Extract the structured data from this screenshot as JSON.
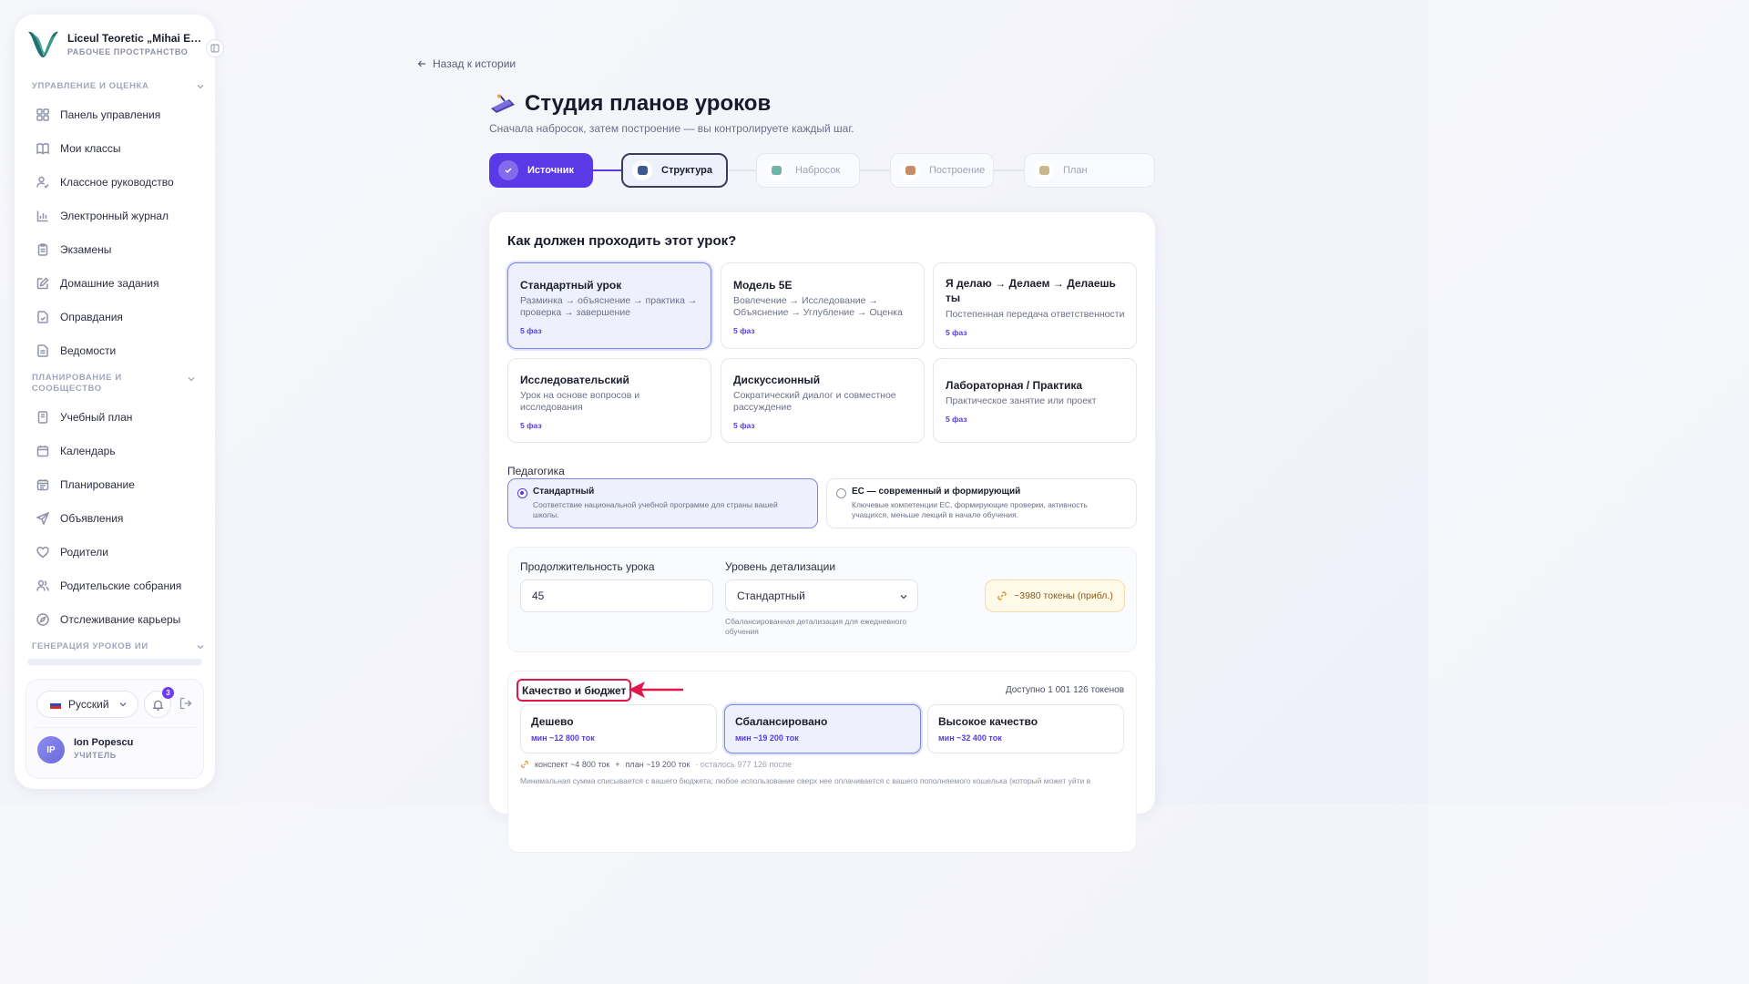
{
  "sidebar": {
    "school_name": "Liceul Teoretic „Mihai Eminescu”",
    "workspace_label": "РАБОЧЕЕ ПРОСТРАНСТВО",
    "sections": [
      {
        "title": "УПРАВЛЕНИЕ И ОЦЕНКА"
      },
      {
        "title": "ПЛАНИРОВАНИЕ И СООБЩЕСТВО"
      },
      {
        "title": "ГЕНЕРАЦИЯ УРОКОВ ИИ"
      }
    ],
    "items": [
      {
        "label": "Панель управления",
        "icon": "dashboard-icon"
      },
      {
        "label": "Мои классы",
        "icon": "book-icon"
      },
      {
        "label": "Классное руководство",
        "icon": "user-check-icon"
      },
      {
        "label": "Электронный журнал",
        "icon": "bar-chart-icon"
      },
      {
        "label": "Экзамены",
        "icon": "clipboard-icon"
      },
      {
        "label": "Домашние задания",
        "icon": "edit-icon"
      },
      {
        "label": "Оправдания",
        "icon": "file-check-icon"
      },
      {
        "label": "Ведомости",
        "icon": "file-text-icon"
      },
      {
        "label": "Учебный план",
        "icon": "notebook-icon"
      },
      {
        "label": "Календарь",
        "icon": "calendar-icon"
      },
      {
        "label": "Планирование",
        "icon": "calendar-plan-icon"
      },
      {
        "label": "Объявления",
        "icon": "send-icon"
      },
      {
        "label": "Родители",
        "icon": "heart-icon"
      },
      {
        "label": "Родительские собрания",
        "icon": "users-icon"
      },
      {
        "label": "Отслеживание карьеры",
        "icon": "compass-icon"
      }
    ],
    "language": "Русский",
    "notifications_count": "3",
    "user": {
      "initials": "IP",
      "name": "Ion Popescu",
      "role": "УЧИТЕЛЬ"
    }
  },
  "main": {
    "back_label": "Назад к истории",
    "title": "Студия планов уроков",
    "subtitle": "Сначала набросок, затем построение — вы контролируете каждый шаг.",
    "steps": [
      {
        "label": "Источник",
        "state": "done"
      },
      {
        "label": "Структура",
        "state": "active"
      },
      {
        "label": "Набросок",
        "state": "todo"
      },
      {
        "label": "Построение",
        "state": "todo"
      },
      {
        "label": "План",
        "state": "todo"
      }
    ],
    "question": "Как должен проходить этот урок?",
    "templates": [
      {
        "title": "Стандартный урок",
        "desc": "Разминка → объяснение → практика → проверка → завершение",
        "phases": "5 фаз",
        "selected": true
      },
      {
        "title": "Модель 5E",
        "desc": "Вовлечение → Исследование → Объяснение → Углубление → Оценка",
        "phases": "5 фаз",
        "selected": false
      },
      {
        "title": "Я делаю → Делаем → Делаешь ты",
        "desc": "Постепенная передача ответственности",
        "phases": "5 фаз",
        "selected": false
      },
      {
        "title": "Исследовательский",
        "desc": "Урок на основе вопросов и исследования",
        "phases": "5 фаз",
        "selected": false
      },
      {
        "title": "Дискуссионный",
        "desc": "Сократический диалог и совместное рассуждение",
        "phases": "5 фаз",
        "selected": false
      },
      {
        "title": "Лабораторная / Практика",
        "desc": "Практическое занятие или проект",
        "phases": "5 фаз",
        "selected": false
      }
    ],
    "pedagogy": {
      "label": "Педагогика",
      "options": [
        {
          "title": "Стандартный",
          "desc": "Соответствие национальной учебной программе для страны вашей школы.",
          "selected": true
        },
        {
          "title": "EC — современный и формирующий",
          "desc": "Ключевые компетенции ЕС, формирующие проверки, активность учащихся, меньше лекций в начале обучения.",
          "selected": false
        }
      ]
    },
    "duration": {
      "label": "Продолжительность урока",
      "value": "45"
    },
    "detail": {
      "label": "Уровень детализации",
      "value": "Стандартный",
      "hint": "Сбалансированная детализация для ежедневного обучения"
    },
    "token_estimate": "~3980 токены (прибл.)",
    "quality": {
      "title": "Качество и бюджет",
      "available": "Доступно 1 001 126 токенов",
      "tiers": [
        {
          "name": "Дешево",
          "min": "мин ~12 800 ток",
          "selected": false
        },
        {
          "name": "Сбалансировано",
          "min": "мин ~19 200 ток",
          "selected": true
        },
        {
          "name": "Высокое качество",
          "min": "мин ~32 400 ток",
          "selected": false
        }
      ],
      "breakdown_outline": "конспект ~4 800 ток",
      "breakdown_plus": "+",
      "breakdown_plan": "план ~19 200 ток",
      "breakdown_remaining": "· осталось 977 126 после",
      "note": "Минимальная сумма списывается с вашего бюджета; любое использование сверх нее оплачивается с вашего пополняемого кошелька (который может уйти в"
    }
  },
  "colors": {
    "accent": "#5a3ae6",
    "highlight": "#e0174b",
    "selected_bg": "#eef0fd",
    "token_bg": "#fff9e8"
  }
}
